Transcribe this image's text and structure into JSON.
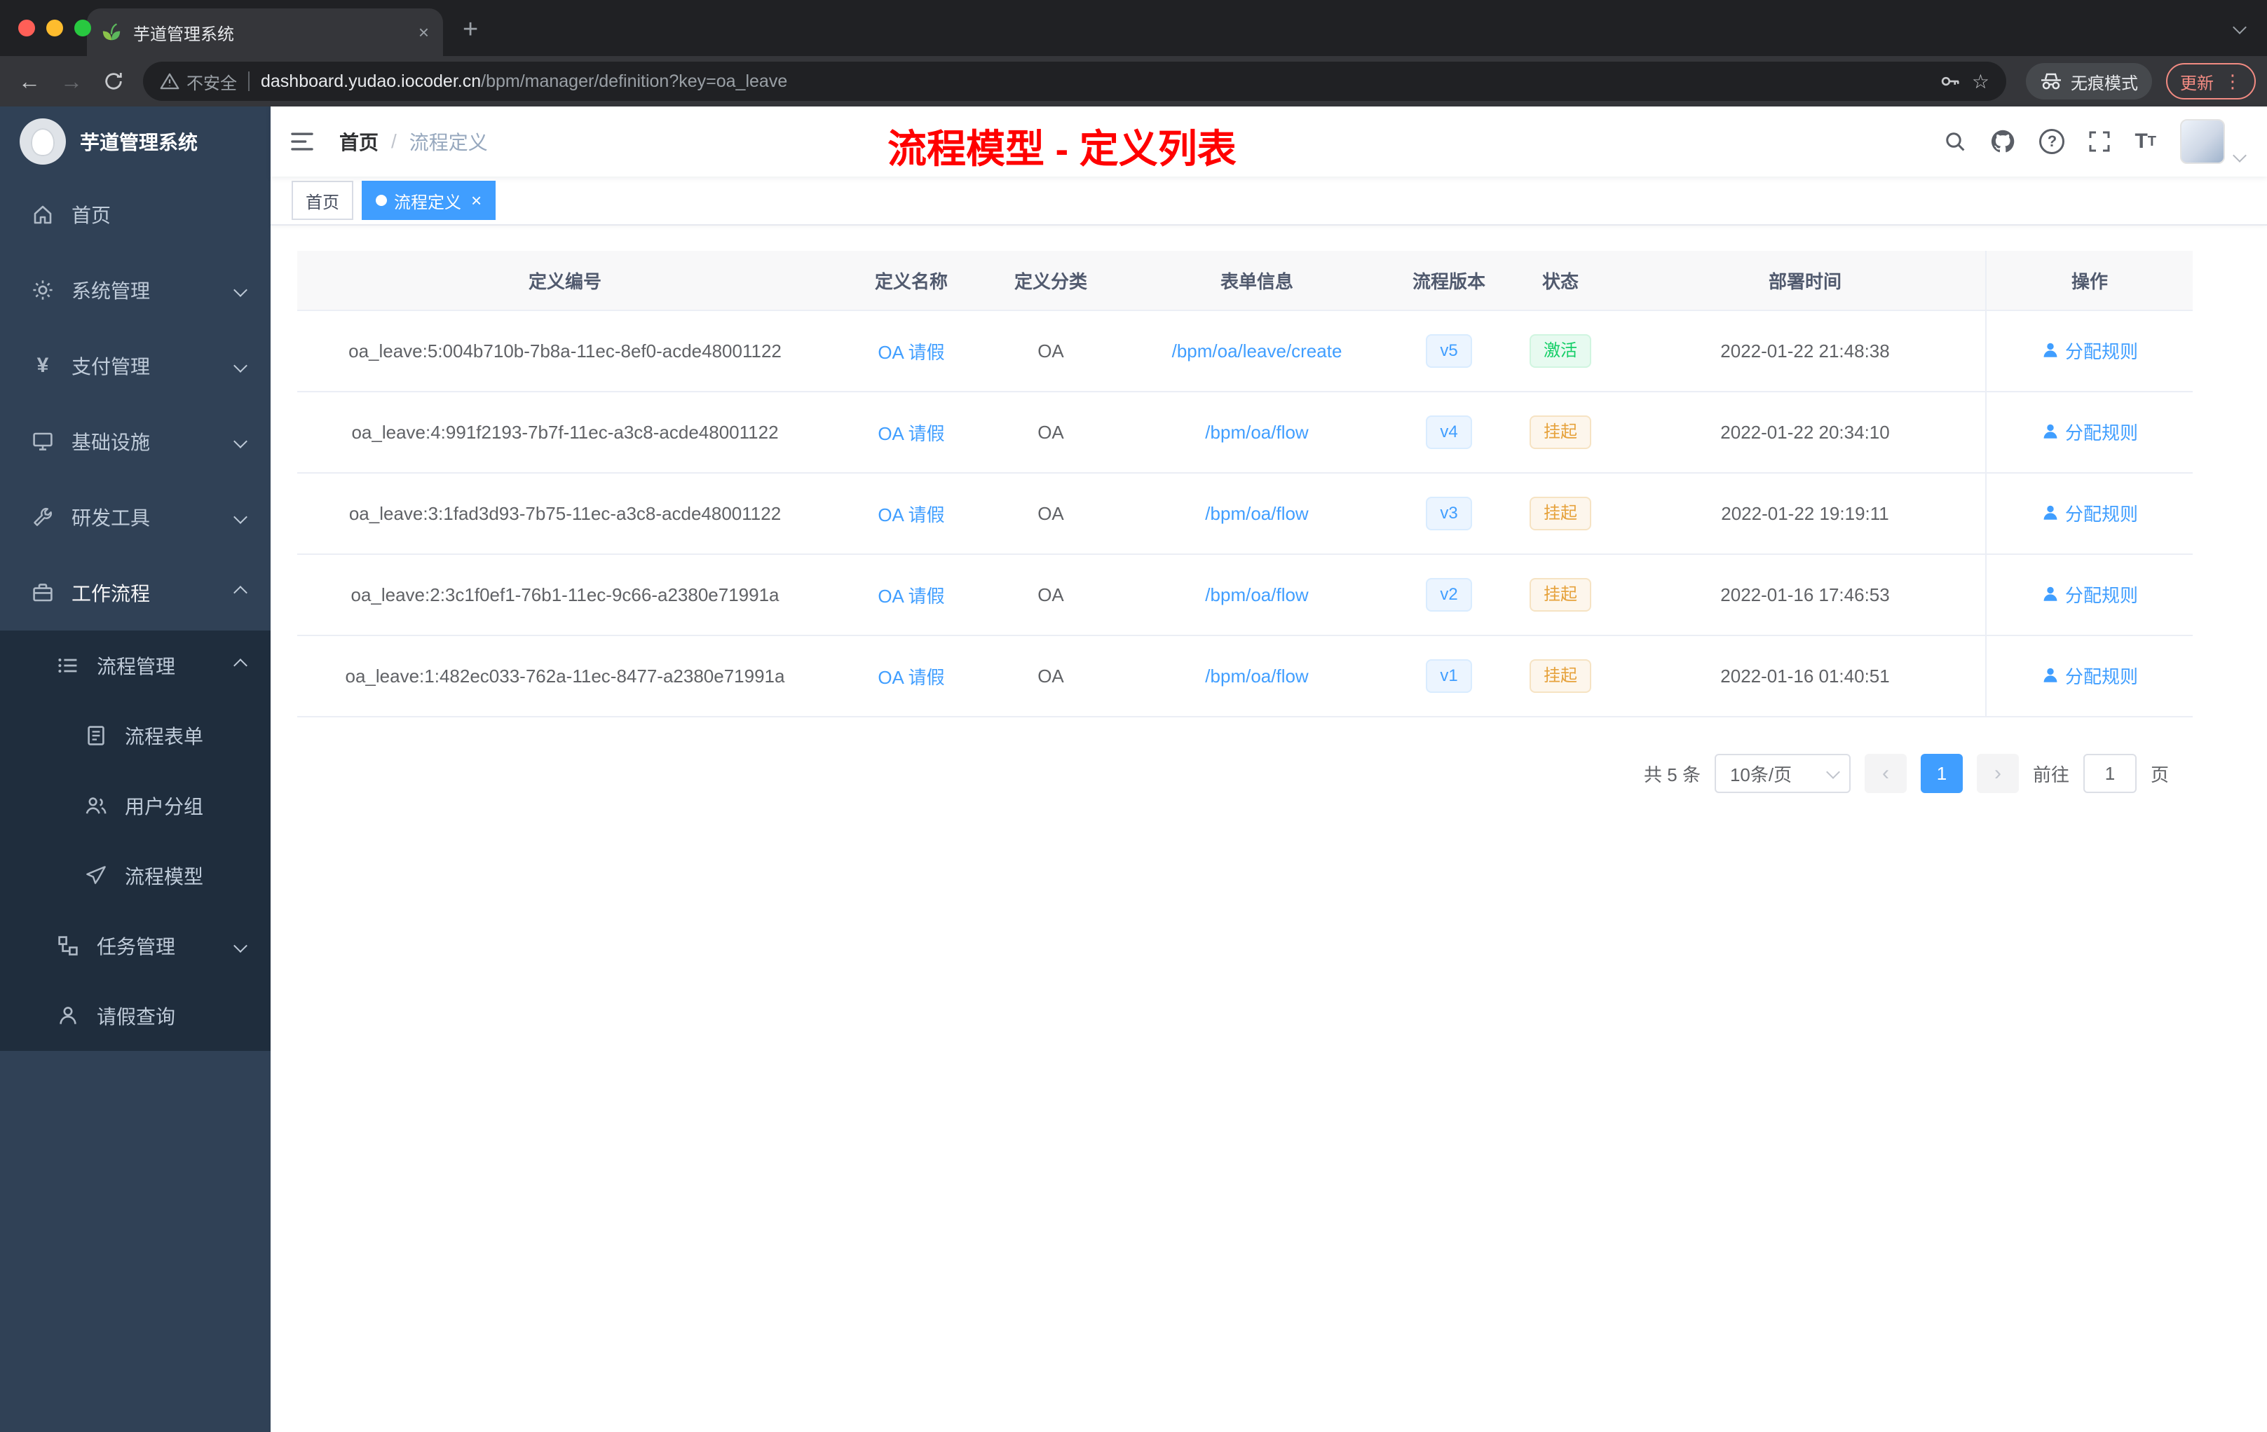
{
  "browser": {
    "tab_title": "芋道管理系统",
    "security_label": "不安全",
    "url_domain": "dashboard.yudao.iocoder.cn",
    "url_path": "/bpm/manager/definition?key=oa_leave",
    "incognito_label": "无痕模式",
    "update_label": "更新"
  },
  "sidebar": {
    "logo_title": "芋道管理系统",
    "menu": [
      {
        "label": "首页",
        "icon": "home-icon",
        "arrow": "",
        "level": 1
      },
      {
        "label": "系统管理",
        "icon": "gear-icon",
        "arrow": "down",
        "level": 1
      },
      {
        "label": "支付管理",
        "icon": "payment-icon",
        "arrow": "down",
        "level": 1
      },
      {
        "label": "基础设施",
        "icon": "infrastructure-icon",
        "arrow": "down",
        "level": 1
      },
      {
        "label": "研发工具",
        "icon": "devtools-icon",
        "arrow": "down",
        "level": 1
      },
      {
        "label": "工作流程",
        "icon": "workflow-icon",
        "arrow": "up",
        "level": 1,
        "active": true
      }
    ],
    "submenu": [
      {
        "label": "流程管理",
        "icon": "process-list-icon",
        "arrow": "up",
        "level": 2
      },
      {
        "label": "流程表单",
        "icon": "form-icon",
        "level": 3
      },
      {
        "label": "用户分组",
        "icon": "user-group-icon",
        "level": 3
      },
      {
        "label": "流程模型",
        "icon": "process-model-icon",
        "level": 3
      },
      {
        "label": "任务管理",
        "icon": "task-icon",
        "arrow": "down",
        "level": 2
      },
      {
        "label": "请假查询",
        "icon": "person-icon",
        "level": 2
      }
    ]
  },
  "header": {
    "breadcrumb_home": "首页",
    "breadcrumb_sep": "/",
    "breadcrumb_current": "流程定义",
    "page_title": "流程模型 - 定义列表"
  },
  "tags": [
    {
      "label": "首页",
      "active": false
    },
    {
      "label": "流程定义",
      "active": true
    }
  ],
  "table": {
    "columns": [
      "定义编号",
      "定义名称",
      "定义分类",
      "表单信息",
      "流程版本",
      "状态",
      "部署时间",
      "操作"
    ],
    "action_label": "分配规则",
    "rows": [
      {
        "id": "oa_leave:5:004b710b-7b8a-11ec-8ef0-acde48001122",
        "name": "OA 请假",
        "category": "OA",
        "form": "/bpm/oa/leave/create",
        "version": "v5",
        "status": "激活",
        "status_type": "success",
        "deployed_at": "2022-01-22 21:48:38"
      },
      {
        "id": "oa_leave:4:991f2193-7b7f-11ec-a3c8-acde48001122",
        "name": "OA 请假",
        "category": "OA",
        "form": "/bpm/oa/flow",
        "version": "v4",
        "status": "挂起",
        "status_type": "warning",
        "deployed_at": "2022-01-22 20:34:10"
      },
      {
        "id": "oa_leave:3:1fad3d93-7b75-11ec-a3c8-acde48001122",
        "name": "OA 请假",
        "category": "OA",
        "form": "/bpm/oa/flow",
        "version": "v3",
        "status": "挂起",
        "status_type": "warning",
        "deployed_at": "2022-01-22 19:19:11"
      },
      {
        "id": "oa_leave:2:3c1f0ef1-76b1-11ec-9c66-a2380e71991a",
        "name": "OA 请假",
        "category": "OA",
        "form": "/bpm/oa/flow",
        "version": "v2",
        "status": "挂起",
        "status_type": "warning",
        "deployed_at": "2022-01-16 17:46:53"
      },
      {
        "id": "oa_leave:1:482ec033-762a-11ec-8477-a2380e71991a",
        "name": "OA 请假",
        "category": "OA",
        "form": "/bpm/oa/flow",
        "version": "v1",
        "status": "挂起",
        "status_type": "warning",
        "deployed_at": "2022-01-16 01:40:51"
      }
    ]
  },
  "pagination": {
    "total": "共 5 条",
    "page_size": "10条/页",
    "current_page": "1",
    "goto_label": "前往",
    "goto_value": "1",
    "goto_unit": "页"
  },
  "colors": {
    "accent": "#409eff",
    "success": "#13ce66",
    "warning": "#e6a23c",
    "title_red": "#ff0000",
    "sidebar_bg": "#304156",
    "submenu_bg": "#1f2d3d"
  }
}
